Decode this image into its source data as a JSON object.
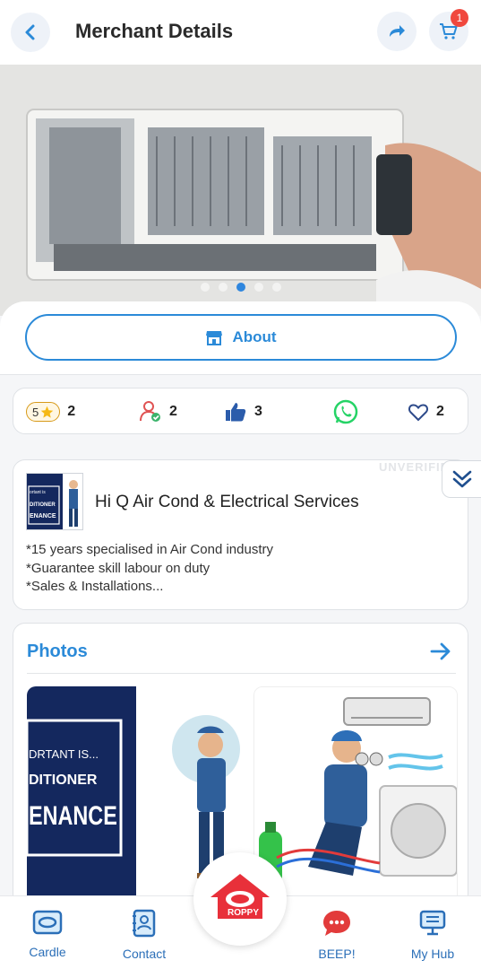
{
  "header": {
    "title": "Merchant Details",
    "cart_count": "1"
  },
  "hero": {
    "slides": 5,
    "active_slide": 3
  },
  "about": {
    "label": "About"
  },
  "stats": {
    "rating": "5",
    "rating_count": "2",
    "followers": "2",
    "likes": "3",
    "favorites": "2"
  },
  "merchant": {
    "name": "Hi Q Air Cond & Electrical Services",
    "description_lines": [
      "*15 years specialised in Air Cond industry",
      "*Guarantee skill labour on duty",
      "*Sales & Installations..."
    ],
    "status": "UNVERIFIED",
    "logo_text": [
      "ortant is",
      "DITIONER",
      "ENANCE"
    ]
  },
  "photos": {
    "title": "Photos",
    "photo1_text": [
      "DRTANT IS...",
      "DITIONER",
      "ENANCE"
    ]
  },
  "bottom_nav": {
    "items": [
      {
        "label": "Cardle",
        "icon": "card-icon"
      },
      {
        "label": "Contact",
        "icon": "contact-book-icon"
      },
      {
        "label": "BEEP!",
        "icon": "chat-bubble-icon"
      },
      {
        "label": "My Hub",
        "icon": "monitor-icon"
      }
    ],
    "center_label": "ROPPY"
  },
  "colors": {
    "accent": "#2b8ad8",
    "badge": "#f0483e",
    "whatsapp": "#25d366",
    "roppy_red": "#e8303a"
  }
}
